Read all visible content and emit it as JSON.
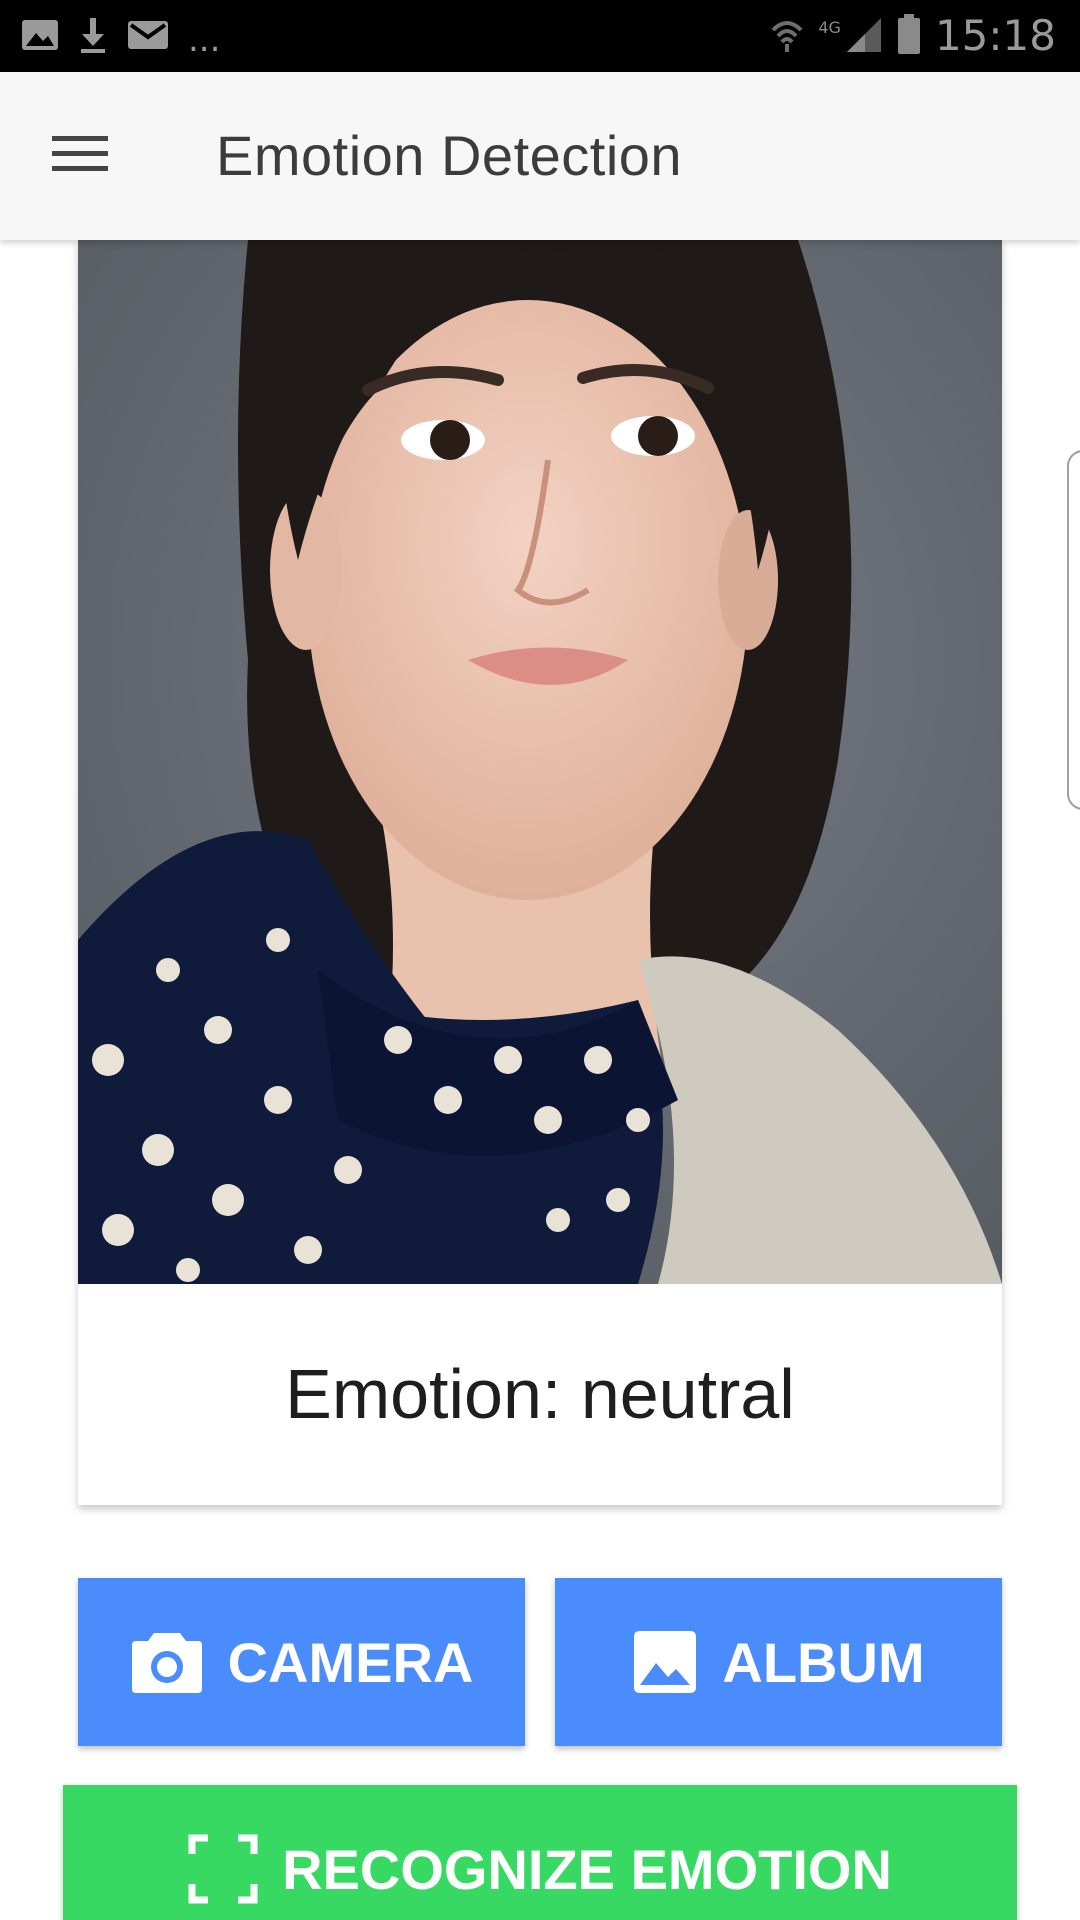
{
  "status_bar": {
    "left_icons": [
      "image-icon",
      "download-icon",
      "mail-icon"
    ],
    "more": "...",
    "network": "4G",
    "right_icons": [
      "wifi-icon",
      "signal-icon",
      "battery-icon"
    ],
    "time": "15:18"
  },
  "app_bar": {
    "menu_icon": "menu-icon",
    "title": "Emotion Detection"
  },
  "card": {
    "photo_description_icon": "portrait-photo",
    "emotion_text": "Emotion: neutral"
  },
  "buttons": {
    "camera": {
      "label": "CAMERA",
      "icon": "camera-icon"
    },
    "album": {
      "label": "ALBUM",
      "icon": "image-icon"
    },
    "recognize": {
      "label": "RECOGNIZE EMOTION",
      "icon": "scan-frame-icon"
    }
  },
  "colors": {
    "primary_button": "#4a8cfb",
    "recognize_button": "#38d963",
    "app_bar_bg": "#f7f7f7",
    "status_bar_bg": "#000000"
  }
}
